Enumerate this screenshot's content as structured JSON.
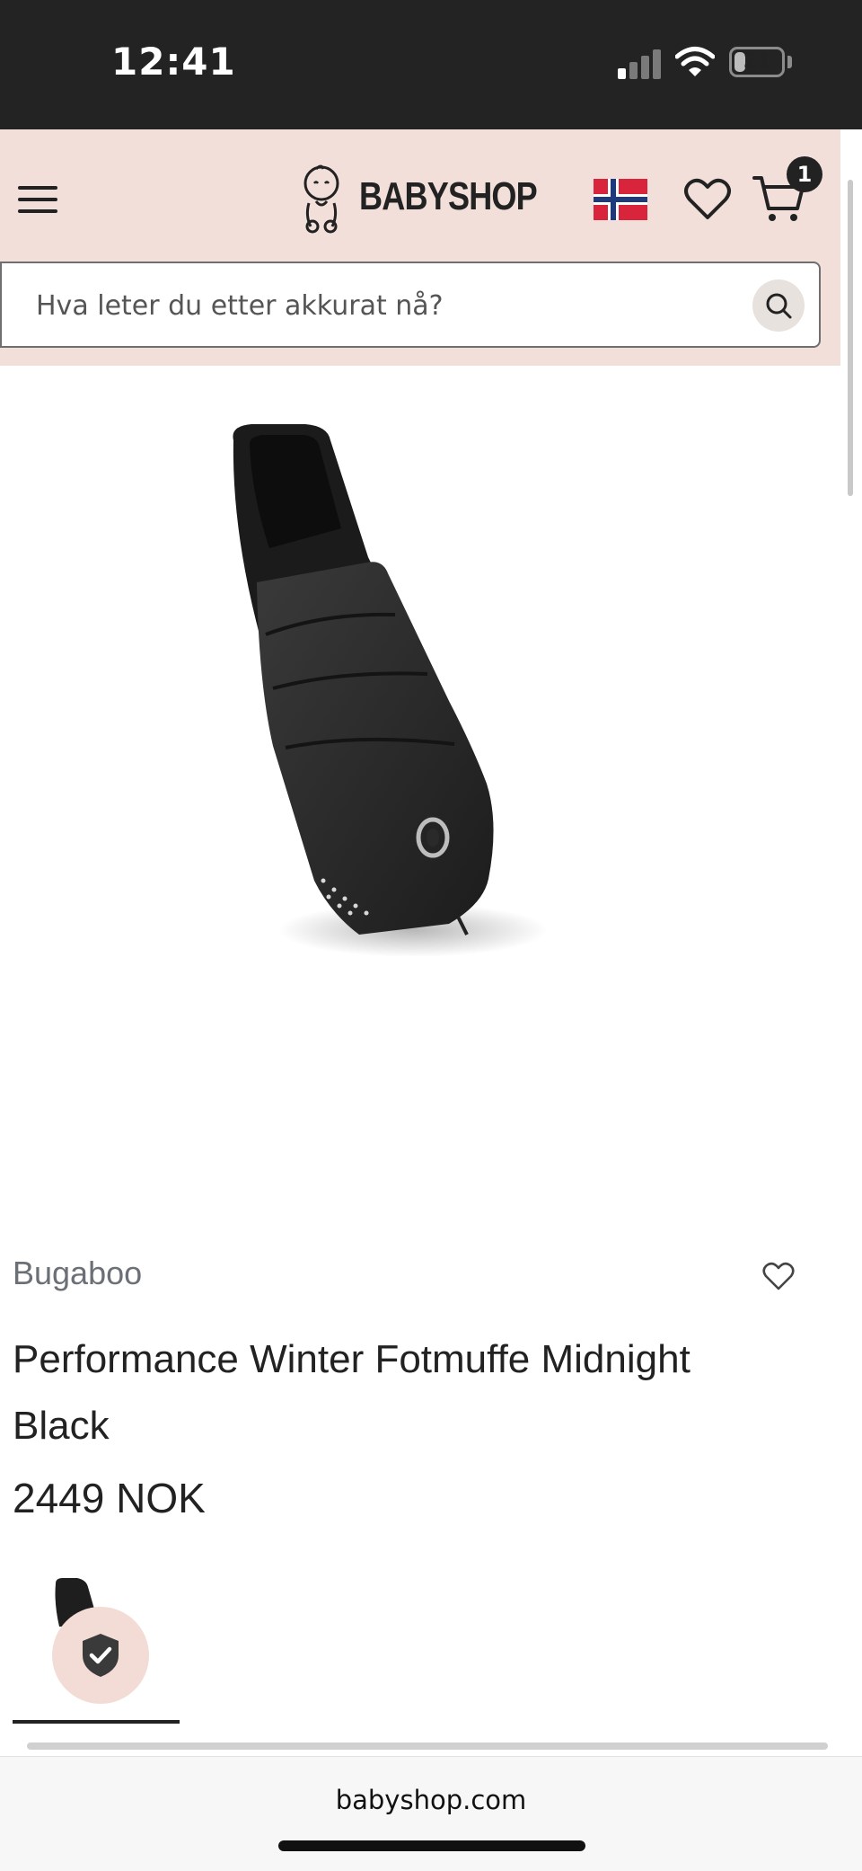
{
  "status_bar": {
    "time": "12:41",
    "battery": "21",
    "battery_level": 0.21
  },
  "header": {
    "logo_text": "BABYSHOP",
    "cart_count": "1",
    "country_flag": "norway-flag-icon",
    "colors": {
      "header_bg": "#f2dfd9",
      "flag_red": "#d9253c",
      "flag_blue": "#1f3a7a"
    }
  },
  "search": {
    "placeholder": "Hva leter du etter akkurat nå?"
  },
  "product": {
    "brand": "Bugaboo",
    "title": "Performance Winter Fotmuffe Midnight Black",
    "price": "2449 NOK"
  },
  "browser": {
    "url": "babyshop.com"
  }
}
